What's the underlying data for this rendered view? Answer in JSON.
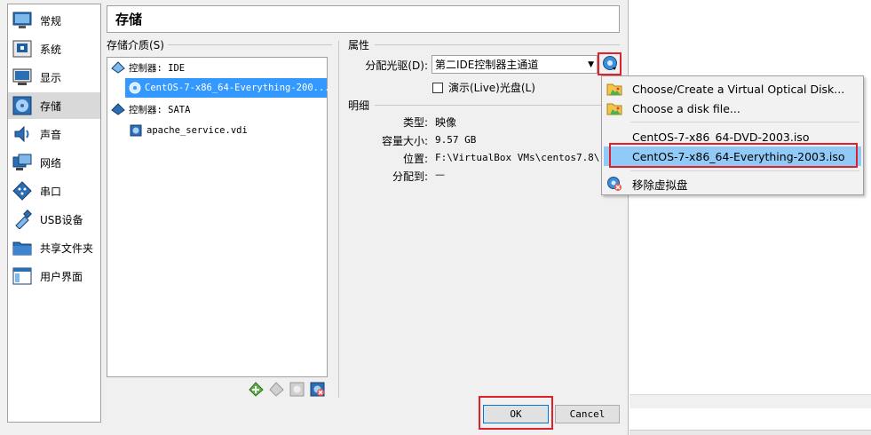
{
  "sidebar": {
    "items": [
      {
        "label": "常规",
        "icon": "general-icon"
      },
      {
        "label": "系统",
        "icon": "system-icon"
      },
      {
        "label": "显示",
        "icon": "display-icon"
      },
      {
        "label": "存储",
        "icon": "storage-icon",
        "selected": true
      },
      {
        "label": "声音",
        "icon": "audio-icon"
      },
      {
        "label": "网络",
        "icon": "network-icon"
      },
      {
        "label": "串口",
        "icon": "serial-port-icon"
      },
      {
        "label": "USB设备",
        "icon": "usb-icon"
      },
      {
        "label": "共享文件夹",
        "icon": "shared-folder-icon"
      },
      {
        "label": "用户界面",
        "icon": "user-interface-icon"
      }
    ]
  },
  "header": {
    "title": "存储"
  },
  "storage": {
    "group_label": "存储介质(S)",
    "controllers": [
      {
        "label": "控制器: IDE",
        "attachments": [
          "CentOS-7-x86_64-Everything-200..."
        ]
      },
      {
        "label": "控制器: SATA",
        "attachments": [
          "apache_service.vdi"
        ]
      }
    ]
  },
  "attributes": {
    "group_label": "属性",
    "optical_drive_label": "分配光驱(D):",
    "optical_drive_value": "第二IDE控制器主通道",
    "live_cd_label": "演示(Live)光盘(L)",
    "live_cd_checked": false
  },
  "details": {
    "group_label": "明细",
    "type_label": "类型:",
    "type_value": "映像",
    "size_label": "容量大小:",
    "size_value": "9.57 GB",
    "location_label": "位置:",
    "location_value": "F:\\VirtualBox VMs\\centos7.8\\Ce",
    "attached_label": "分配到:",
    "attached_value": "—"
  },
  "buttons": {
    "ok": "OK",
    "cancel": "Cancel"
  },
  "menu": {
    "items": [
      {
        "label": "Choose/Create a Virtual Optical Disk...",
        "icon": "folder-icon"
      },
      {
        "label": "Choose a disk file...",
        "icon": "folder-icon"
      },
      {
        "label": "CentOS-7-x86_64-DVD-2003.iso",
        "icon": ""
      },
      {
        "label": "CentOS-7-x86_64-Everything-2003.iso",
        "icon": "",
        "highlighted": true
      },
      {
        "label": "移除虚拟盘",
        "icon": "remove-disc-icon"
      }
    ]
  },
  "colors": {
    "selection": "#3399ff",
    "highlight_frame": "#e0202a",
    "menu_highlight": "#91c9f7"
  }
}
